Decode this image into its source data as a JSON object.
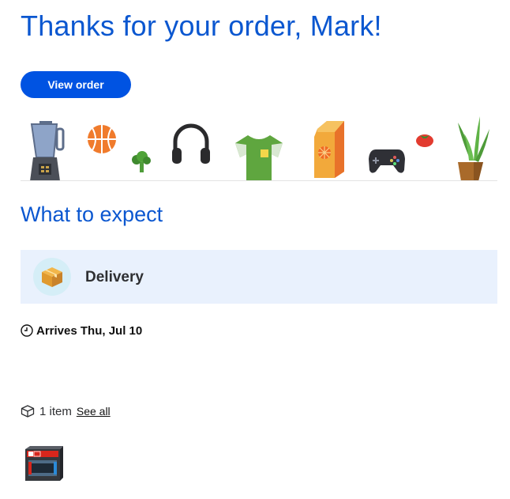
{
  "header": {
    "title": "Thanks for your order, Mark!"
  },
  "actions": {
    "view_order_label": "View order"
  },
  "banner": {
    "icons": [
      "blender-icon",
      "basketball-icon",
      "broccoli-icon",
      "headphones-icon",
      "tshirt-icon",
      "juice-carton-icon",
      "game-controller-icon",
      "tomato-icon",
      "potted-plant-icon"
    ]
  },
  "expect": {
    "title": "What to expect",
    "delivery_label": "Delivery",
    "arrival_text": "Arrives Thu, Jul 10"
  },
  "items": {
    "count_text": "1 item",
    "see_all_label": "See all"
  },
  "colors": {
    "title_blue": "#0b57d0",
    "button_blue": "#0053e2",
    "delivery_bg": "#e9f1fd"
  }
}
